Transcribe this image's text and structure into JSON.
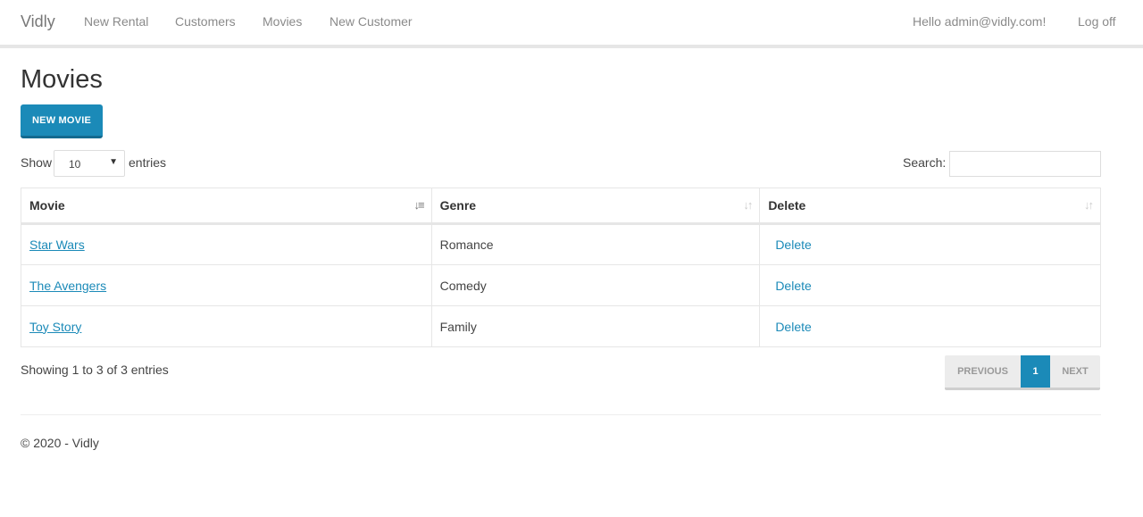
{
  "navbar": {
    "brand": "Vidly",
    "links": [
      "New Rental",
      "Customers",
      "Movies",
      "New Customer"
    ],
    "greeting": "Hello admin@vidly.com!",
    "logoff": "Log off"
  },
  "page": {
    "title": "Movies",
    "new_button": "NEW MOVIE"
  },
  "table_controls": {
    "show_label": "Show",
    "page_length": "10",
    "entries_label": "entries",
    "search_label": "Search:",
    "search_value": ""
  },
  "table": {
    "columns": [
      "Movie",
      "Genre",
      "Delete"
    ],
    "rows": [
      {
        "movie": "Star Wars",
        "genre": "Romance",
        "action": "Delete"
      },
      {
        "movie": "The Avengers",
        "genre": "Comedy",
        "action": "Delete"
      },
      {
        "movie": "Toy Story",
        "genre": "Family",
        "action": "Delete"
      }
    ]
  },
  "table_info": "Showing 1 to 3 of 3 entries",
  "pagination": {
    "previous": "PREVIOUS",
    "current": "1",
    "next": "NEXT"
  },
  "footer": "© 2020 - Vidly",
  "colors": {
    "accent": "#1b8ab8",
    "nav_text": "#8a8a8a"
  }
}
